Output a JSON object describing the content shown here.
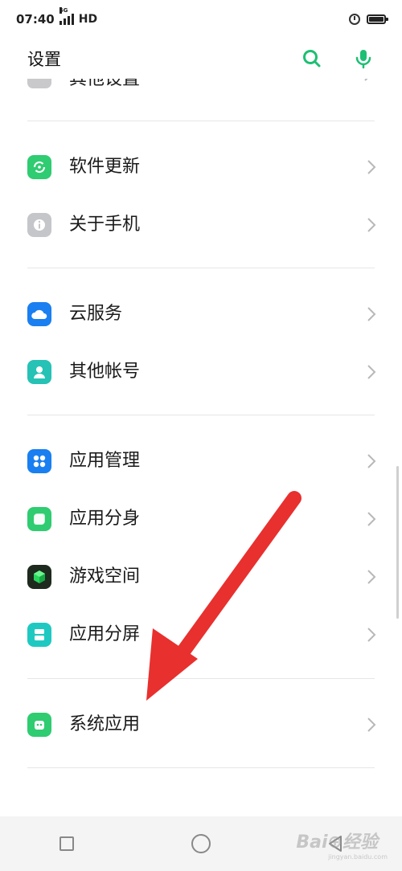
{
  "status": {
    "time": "07:40",
    "network_tag": "4G",
    "network": "HD"
  },
  "header": {
    "title": "设置",
    "accent_color": "#1dbf73"
  },
  "list": {
    "partial_label": "其他设置",
    "items": [
      {
        "label": "软件更新",
        "icon": "refresh-icon",
        "color": "#2fcc71"
      },
      {
        "label": "关于手机",
        "icon": "info-icon",
        "color": "#c5c6ca"
      },
      {
        "label": "云服务",
        "icon": "cloud-icon",
        "color": "#1a7ff0"
      },
      {
        "label": "其他帐号",
        "icon": "account-icon",
        "color": "#25c2b5"
      },
      {
        "label": "应用管理",
        "icon": "apps-grid-icon",
        "color": "#1a7ff0"
      },
      {
        "label": "应用分身",
        "icon": "clone-icon",
        "color": "#2fcc71"
      },
      {
        "label": "游戏空间",
        "icon": "game-cube-icon",
        "color": "#1d2a1d"
      },
      {
        "label": "应用分屏",
        "icon": "split-screen-icon",
        "color": "#1fc9c1"
      },
      {
        "label": "系统应用",
        "icon": "android-icon",
        "color": "#2fcc71"
      }
    ]
  },
  "watermark": {
    "text": "Bai⊕经验",
    "sub": "jingyan.baidu.com"
  },
  "annotation": {
    "arrow_color": "#e8302e"
  }
}
